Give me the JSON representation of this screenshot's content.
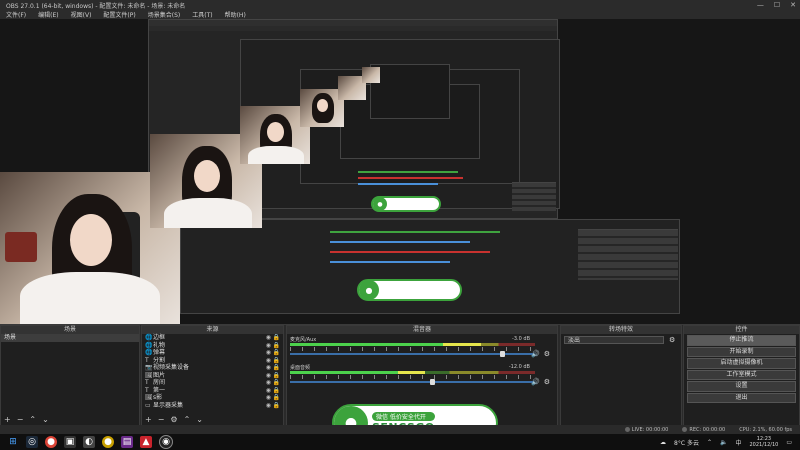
{
  "window": {
    "title": "OBS 27.0.1 (64-bit, windows) - 配置文件: 未命名 - 场景: 未命名",
    "minimize": "—",
    "maximize": "☐",
    "close": "✕"
  },
  "menu": [
    "文件(F)",
    "编辑(E)",
    "视图(V)",
    "配置文件(P)",
    "场景集合(S)",
    "工具(T)",
    "帮助(H)"
  ],
  "watermark": {
    "pill_text": "微信 低价安全代开",
    "brand": "SENCSGO"
  },
  "panels": {
    "scenes_title": "场景",
    "sources_title": "来源",
    "mixer_title": "混音器",
    "transitions_title": "转场特效",
    "controls_title": "控件"
  },
  "scenes": [
    "场景"
  ],
  "sources": [
    {
      "icon": "🌐",
      "label": "边框"
    },
    {
      "icon": "🌐",
      "label": "礼物"
    },
    {
      "icon": "🌐",
      "label": "弹幕"
    },
    {
      "icon": "T",
      "label": "分割"
    },
    {
      "icon": "📷",
      "label": "视频采集设备"
    },
    {
      "icon": "🖼",
      "label": "图片"
    },
    {
      "icon": "T",
      "label": "房间"
    },
    {
      "icon": "T",
      "label": "第一"
    },
    {
      "icon": "🖼",
      "label": "s影"
    },
    {
      "icon": "▭",
      "label": "显示器采集"
    }
  ],
  "mixer": [
    {
      "name": "麦克风/Aux",
      "db": "-3.0 dB",
      "level": 0.78,
      "fader": 0.86
    },
    {
      "name": "桌面音频",
      "db": "-12.0 dB",
      "level": 0.55,
      "fader": 0.57
    }
  ],
  "transition": {
    "selected": "淡出"
  },
  "controls": [
    "停止推流",
    "开始录制",
    "启动虚拟摄像机",
    "工作室模式",
    "设置",
    "退出"
  ],
  "status": {
    "live": "LIVE: 00:00:00",
    "rec": "REC: 00:00:00",
    "cpu": "CPU: 2.1%, 60.00 fps"
  },
  "taskbar": {
    "weather": "8°C 多云",
    "time": "12:23",
    "date": "2021/12/10",
    "lang": "中"
  },
  "colors": {
    "accent_green": "#3ca33c",
    "panel_bg": "#1f1f1f"
  }
}
